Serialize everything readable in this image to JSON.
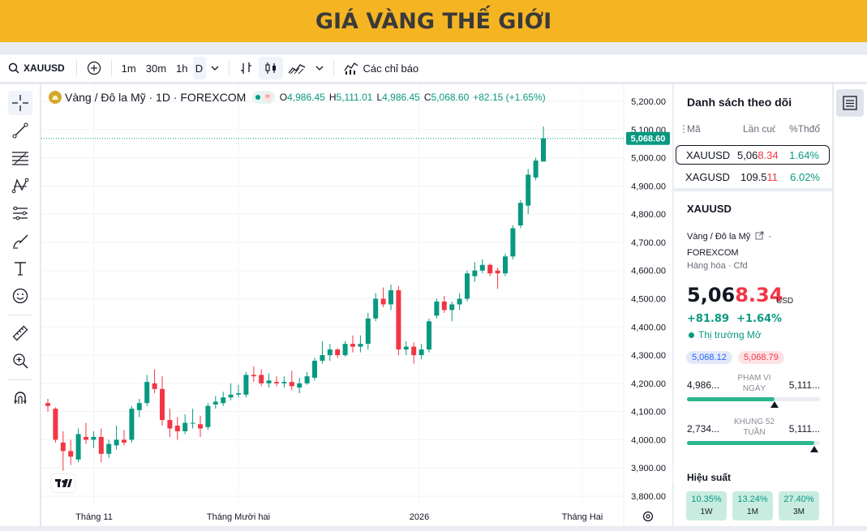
{
  "banner": {
    "title": "GIÁ VÀNG THẾ GIỚI"
  },
  "toolbar": {
    "symbol": "XAUUSD",
    "intervals": [
      "1m",
      "30m",
      "1h",
      "D"
    ],
    "active_interval": "D",
    "indicators_label": "Các chỉ báo"
  },
  "legend": {
    "title": "Vàng / Đô la Mỹ · 1D · FOREXCOM",
    "o_key": "O",
    "o_val": "4,986.45",
    "h_key": "H",
    "h_val": "5,111.01",
    "l_key": "L",
    "l_val": "4,986.45",
    "c_key": "C",
    "c_val": "5,068.60",
    "change": "+82.15 (+1.65%)"
  },
  "chart_data": {
    "type": "candlestick",
    "yticks": [
      "5,200.00",
      "5,100.00",
      "5,000.00",
      "4,900.00",
      "4,800.00",
      "4,700.00",
      "4,600.00",
      "4,500.00",
      "4,400.00",
      "4,300.00",
      "4,200.00",
      "4,100.00",
      "4,000.00",
      "3,900.00",
      "3,800.00"
    ],
    "ylim": [
      3770,
      5230
    ],
    "xticks": [
      "Tháng 11",
      "Tháng Mười hai",
      "2026",
      "Tháng Hai"
    ],
    "last_price_label": "5,068.60",
    "last_price": 5068.6,
    "up_color": "#089981",
    "down_color": "#f23645",
    "candles": [
      {
        "o": 4130,
        "h": 4145,
        "l": 4100,
        "c": 4120
      },
      {
        "o": 4110,
        "h": 4115,
        "l": 3990,
        "c": 4000
      },
      {
        "o": 3990,
        "h": 4030,
        "l": 3890,
        "c": 3960
      },
      {
        "o": 3960,
        "h": 4000,
        "l": 3910,
        "c": 3940
      },
      {
        "o": 3930,
        "h": 4040,
        "l": 3920,
        "c": 4020
      },
      {
        "o": 4010,
        "h": 4060,
        "l": 3985,
        "c": 4000
      },
      {
        "o": 4000,
        "h": 4030,
        "l": 3970,
        "c": 4010
      },
      {
        "o": 4010,
        "h": 4040,
        "l": 3920,
        "c": 3950
      },
      {
        "o": 3950,
        "h": 4000,
        "l": 3935,
        "c": 3985
      },
      {
        "o": 3980,
        "h": 4050,
        "l": 3965,
        "c": 4000
      },
      {
        "o": 4000,
        "h": 4035,
        "l": 3980,
        "c": 3990
      },
      {
        "o": 4000,
        "h": 4120,
        "l": 3990,
        "c": 4110
      },
      {
        "o": 4105,
        "h": 4145,
        "l": 4080,
        "c": 4130
      },
      {
        "o": 4130,
        "h": 4230,
        "l": 4120,
        "c": 4205
      },
      {
        "o": 4200,
        "h": 4250,
        "l": 4165,
        "c": 4180
      },
      {
        "o": 4180,
        "h": 4225,
        "l": 4050,
        "c": 4070
      },
      {
        "o": 4070,
        "h": 4110,
        "l": 4010,
        "c": 4040
      },
      {
        "o": 4050,
        "h": 4080,
        "l": 4000,
        "c": 4030
      },
      {
        "o": 4030,
        "h": 4090,
        "l": 4020,
        "c": 4060
      },
      {
        "o": 4060,
        "h": 4110,
        "l": 4040,
        "c": 4060
      },
      {
        "o": 4055,
        "h": 4085,
        "l": 4010,
        "c": 4040
      },
      {
        "o": 4045,
        "h": 4130,
        "l": 4035,
        "c": 4120
      },
      {
        "o": 4125,
        "h": 4155,
        "l": 4110,
        "c": 4135
      },
      {
        "o": 4130,
        "h": 4170,
        "l": 4120,
        "c": 4150
      },
      {
        "o": 4150,
        "h": 4200,
        "l": 4140,
        "c": 4160
      },
      {
        "o": 4160,
        "h": 4195,
        "l": 4150,
        "c": 4165
      },
      {
        "o": 4160,
        "h": 4240,
        "l": 4150,
        "c": 4230
      },
      {
        "o": 4230,
        "h": 4260,
        "l": 4205,
        "c": 4225
      },
      {
        "o": 4230,
        "h": 4250,
        "l": 4190,
        "c": 4200
      },
      {
        "o": 4200,
        "h": 4235,
        "l": 4185,
        "c": 4210
      },
      {
        "o": 4205,
        "h": 4225,
        "l": 4190,
        "c": 4200
      },
      {
        "o": 4200,
        "h": 4225,
        "l": 4185,
        "c": 4205
      },
      {
        "o": 4205,
        "h": 4245,
        "l": 4175,
        "c": 4190
      },
      {
        "o": 4185,
        "h": 4220,
        "l": 4165,
        "c": 4200
      },
      {
        "o": 4200,
        "h": 4240,
        "l": 4195,
        "c": 4225
      },
      {
        "o": 4220,
        "h": 4290,
        "l": 4210,
        "c": 4280
      },
      {
        "o": 4280,
        "h": 4350,
        "l": 4270,
        "c": 4300
      },
      {
        "o": 4300,
        "h": 4340,
        "l": 4280,
        "c": 4320
      },
      {
        "o": 4320,
        "h": 4325,
        "l": 4290,
        "c": 4300
      },
      {
        "o": 4300,
        "h": 4350,
        "l": 4295,
        "c": 4340
      },
      {
        "o": 4340,
        "h": 4370,
        "l": 4310,
        "c": 4330
      },
      {
        "o": 4330,
        "h": 4370,
        "l": 4310,
        "c": 4340
      },
      {
        "o": 4340,
        "h": 4450,
        "l": 4320,
        "c": 4430
      },
      {
        "o": 4430,
        "h": 4520,
        "l": 4420,
        "c": 4500
      },
      {
        "o": 4500,
        "h": 4540,
        "l": 4470,
        "c": 4480
      },
      {
        "o": 4480,
        "h": 4550,
        "l": 4460,
        "c": 4530
      },
      {
        "o": 4530,
        "h": 4545,
        "l": 4300,
        "c": 4320
      },
      {
        "o": 4320,
        "h": 4350,
        "l": 4300,
        "c": 4330
      },
      {
        "o": 4330,
        "h": 4345,
        "l": 4270,
        "c": 4300
      },
      {
        "o": 4300,
        "h": 4340,
        "l": 4285,
        "c": 4320
      },
      {
        "o": 4320,
        "h": 4430,
        "l": 4310,
        "c": 4420
      },
      {
        "o": 4440,
        "h": 4500,
        "l": 4430,
        "c": 4490
      },
      {
        "o": 4490,
        "h": 4510,
        "l": 4450,
        "c": 4460
      },
      {
        "o": 4460,
        "h": 4490,
        "l": 4420,
        "c": 4480
      },
      {
        "o": 4480,
        "h": 4520,
        "l": 4460,
        "c": 4500
      },
      {
        "o": 4500,
        "h": 4600,
        "l": 4490,
        "c": 4590
      },
      {
        "o": 4580,
        "h": 4630,
        "l": 4560,
        "c": 4600
      },
      {
        "o": 4600,
        "h": 4640,
        "l": 4590,
        "c": 4620
      },
      {
        "o": 4620,
        "h": 4625,
        "l": 4580,
        "c": 4590
      },
      {
        "o": 4600,
        "h": 4610,
        "l": 4535,
        "c": 4590
      },
      {
        "o": 4590,
        "h": 4660,
        "l": 4580,
        "c": 4650
      },
      {
        "o": 4650,
        "h": 4760,
        "l": 4640,
        "c": 4750
      },
      {
        "o": 4760,
        "h": 4850,
        "l": 4750,
        "c": 4840
      },
      {
        "o": 4830,
        "h": 4960,
        "l": 4800,
        "c": 4940
      },
      {
        "o": 4930,
        "h": 5000,
        "l": 4920,
        "c": 4990
      },
      {
        "o": 4986.45,
        "h": 5111.01,
        "l": 4986.45,
        "c": 5068.6
      }
    ]
  },
  "watchlist": {
    "title": "Danh sách theo dõi",
    "col_symbol": "Mã",
    "col_last": "Lần cuố",
    "col_change": "%Thđổ",
    "rows": [
      {
        "symbol": "XAUUSD",
        "last_a": "5,06",
        "last_b": "8.34",
        "change": "1.64%"
      },
      {
        "symbol": "XAGUSD",
        "last_a": "109.5",
        "last_b": "11",
        "change": "6.02%"
      }
    ]
  },
  "details": {
    "symbol": "XAUUSD",
    "description": "Vàng / Đô la Mỹ",
    "dot": "·",
    "exchange": "FOREXCOM",
    "category": "Hàng hóa",
    "category_dot": "·",
    "category_type": "Cfd",
    "price_a": "5,06",
    "price_b": "8.34",
    "currency": "USD",
    "change_abs": "+81.89",
    "change_pct": "+1.64%",
    "market_status": "Thị trường Mở",
    "bid": "5,068.12",
    "ask": "5,068.79",
    "day_range": {
      "low": "4,986...",
      "label_1": "PHẠM VI",
      "label_2": "NGÀY",
      "high": "5,111...",
      "fill": 0.66
    },
    "year_range": {
      "low": "2,734...",
      "label_1": "KHUNG 52",
      "label_2": "TUẦN",
      "high": "5,111...",
      "fill": 0.96
    }
  },
  "performance": {
    "title": "Hiệu suất",
    "items": [
      {
        "value": "10.35%",
        "label": "1W"
      },
      {
        "value": "13.24%",
        "label": "1M"
      },
      {
        "value": "27.40%",
        "label": "3M"
      }
    ]
  }
}
